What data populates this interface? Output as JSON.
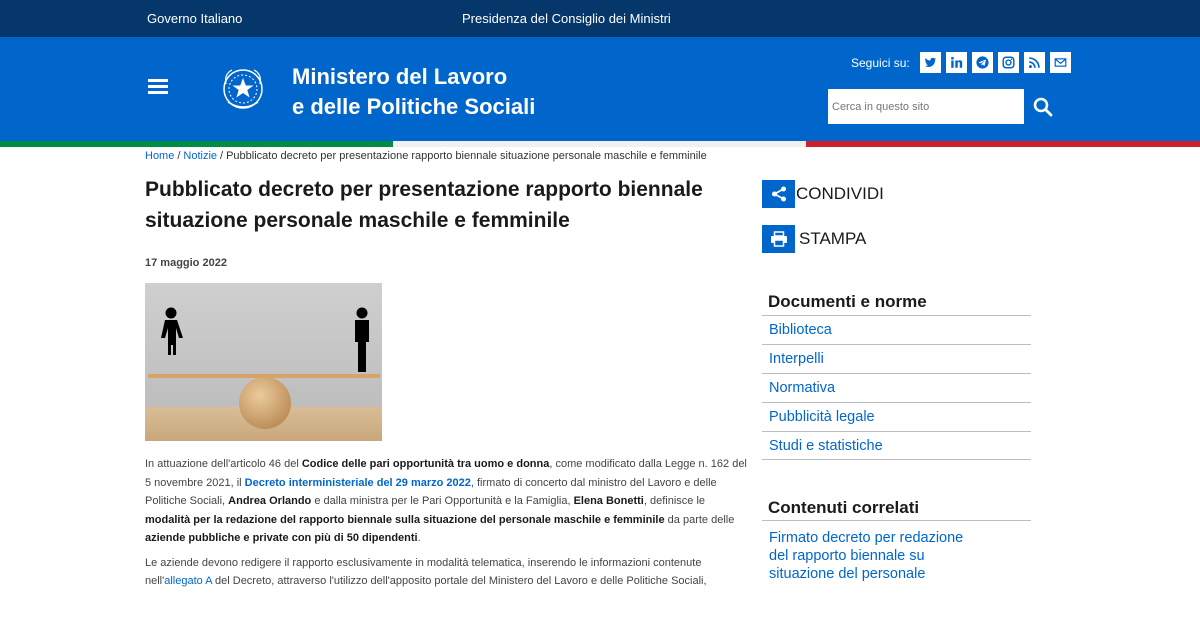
{
  "slim_header": {
    "gov_label": "Governo Italiano",
    "presidency_label": "Presidenza del Consiglio dei Ministri"
  },
  "header": {
    "brand_line1": "Ministero del Lavoro",
    "brand_line2": "e delle Politiche Sociali",
    "social_label": "Seguici su:",
    "social_icons": [
      "twitter-icon",
      "linkedin-icon",
      "telegram-icon",
      "instagram-icon",
      "rss-icon",
      "mail-icon"
    ],
    "search_placeholder": "Cerca in questo sito"
  },
  "colors": {
    "slim_bg": "#06376b",
    "header_bg": "#0066cc",
    "link": "#0066cc",
    "flag_green": "#008c45",
    "flag_red": "#cd212a"
  },
  "breadcrumb": {
    "home": "Home",
    "separator": "/",
    "news": "Notizie",
    "current": "Pubblicato decreto per presentazione rapporto biennale situazione personale maschile e femminile"
  },
  "article": {
    "title_line1": "Pubblicato decreto per presentazione rapporto biennale",
    "title_line2": "situazione personale maschile e femminile",
    "date": "17 maggio 2022",
    "image_description_icons": [
      "woman-icon",
      "man-icon",
      "balance-icon"
    ],
    "p1": {
      "t1": "In attuazione dell'articolo 46 del ",
      "b1": "Codice delle pari opportunità tra uomo e donna",
      "t2": ", come modificato dalla Legge n. 162 del 5 novembre 2021, il ",
      "link1": "Decreto interministeriale del 29 marzo 2022",
      "t3": ", firmato di concerto dal ministro del Lavoro e delle Politiche Sociali, ",
      "b2": "Andrea Orlando",
      "t4": " e dalla ministra per le Pari Opportunità e la Famiglia, ",
      "b3": "Elena Bonetti",
      "t5": ", definisce le ",
      "b4": "modalità per la redazione del rapporto biennale sulla situazione del personale maschile e femminile",
      "t6": " da parte delle ",
      "b5": "aziende pubbliche e private con più di 50 dipendenti",
      "t7": "."
    },
    "p2": {
      "t1": "Le aziende devono redigere il rapporto esclusivamente in modalità telematica, inserendo le informazioni contenute nell'",
      "link1": "allegato A",
      "t2": " del Decreto, attraverso l'utilizzo dell'apposito portale del Ministero del Lavoro e delle Politiche Sociali,"
    }
  },
  "sidebar": {
    "share_label": "CONDIVIDI",
    "print_label": "STAMPA",
    "docs_title": "Documenti e norme",
    "docs_items": [
      "Biblioteca",
      "Interpelli",
      "Normativa",
      "Pubblicità legale",
      "Studi e statistiche"
    ],
    "related_title": "Contenuti correlati",
    "related_line1": "Firmato decreto per redazione",
    "related_line2": "del rapporto biennale su",
    "related_line3": "situazione del personale"
  }
}
